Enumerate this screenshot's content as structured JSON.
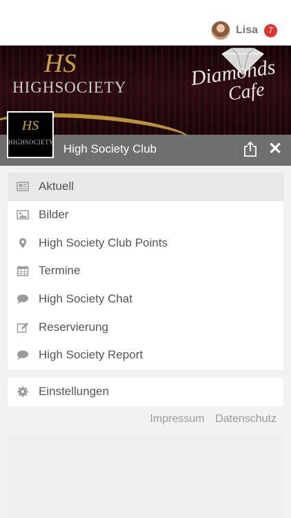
{
  "user": {
    "name": "Lisa",
    "badge_count": "7"
  },
  "hero": {
    "brand_monogram": "HS",
    "brand_left": "HIGHSOCIETY",
    "brand_right_line1": "Diamonds",
    "brand_right_line2": "Cafe"
  },
  "club": {
    "title": "High Society Club",
    "thumb_monogram": "HS",
    "thumb_text": "HIGHSOCIETY"
  },
  "menu": {
    "items": [
      {
        "label": "Aktuell",
        "icon": "newspaper-icon",
        "active": true
      },
      {
        "label": "Bilder",
        "icon": "image-icon"
      },
      {
        "label": "High Society Club Points",
        "icon": "map-pin-icon"
      },
      {
        "label": "Termine",
        "icon": "calendar-icon"
      },
      {
        "label": "High Society Chat",
        "icon": "chat-bubble-icon"
      },
      {
        "label": "Reservierung",
        "icon": "edit-icon"
      },
      {
        "label": "High Society Report",
        "icon": "chat-bubble-icon"
      }
    ],
    "settings": {
      "label": "Einstellungen",
      "icon": "gear-icon"
    }
  },
  "footer": {
    "impressum": "Impressum",
    "datenschutz": "Datenschutz"
  },
  "colors": {
    "badge": "#e6322e",
    "gold": "#c9a23a",
    "active_bg": "#e8e8e8",
    "overlay": "#787878"
  }
}
